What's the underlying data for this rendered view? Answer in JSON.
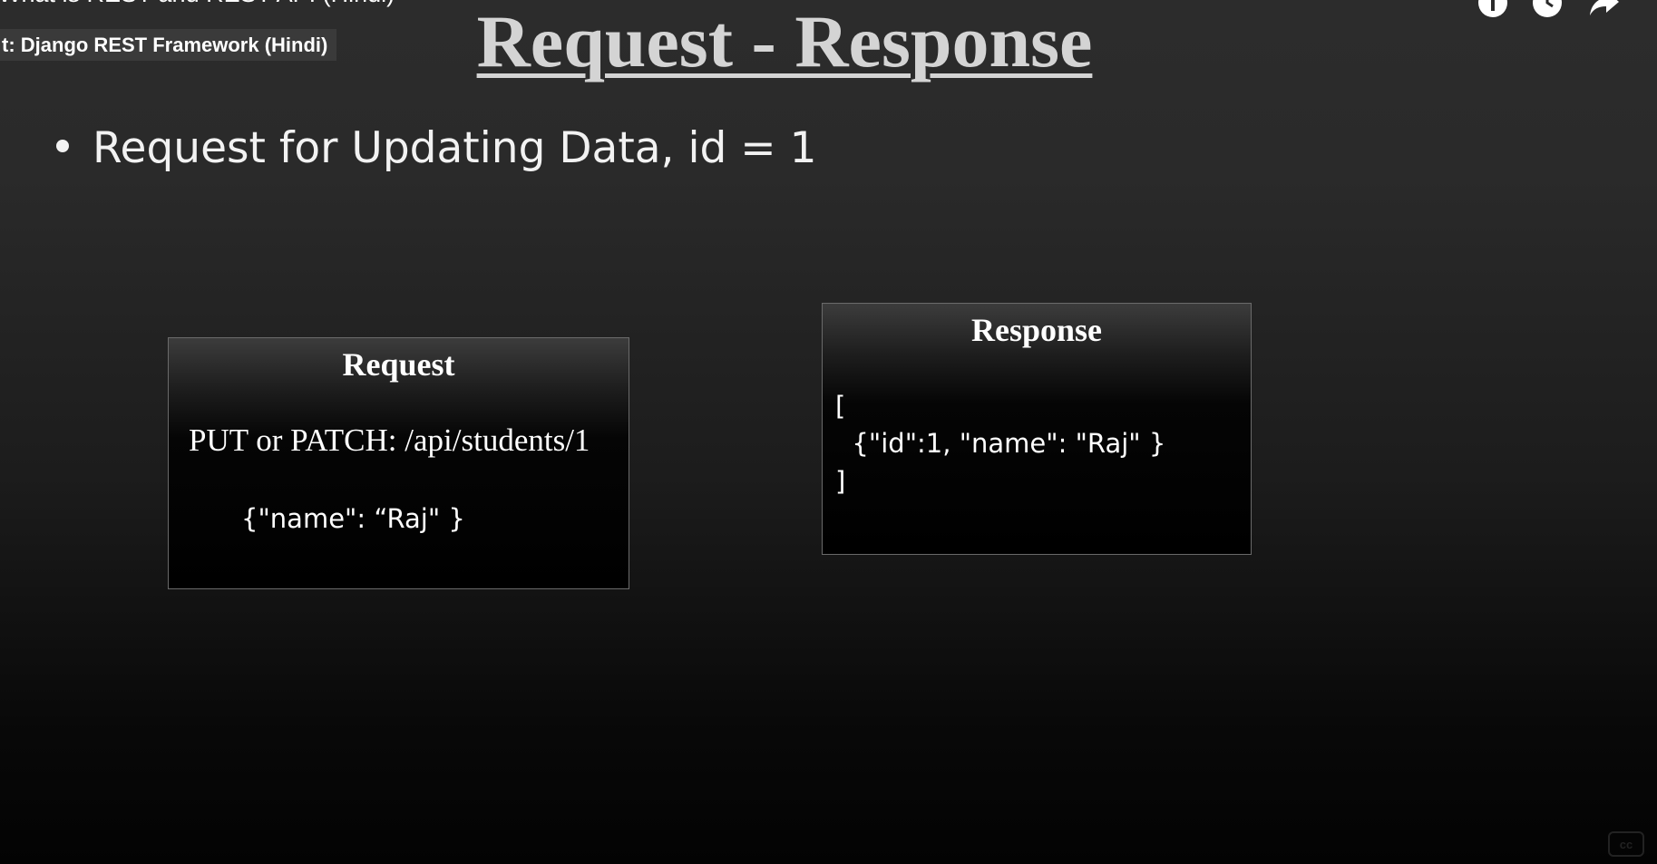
{
  "video": {
    "title": "What is REST and REST API (Hindi)",
    "playlist": "t: Django REST Framework (Hindi)"
  },
  "slide": {
    "title": "Request - Response",
    "bullet": "Request for Updating Data, id = 1",
    "request_box": {
      "heading": "Request",
      "method_line": "PUT or PATCH: /api/students/1",
      "body_line": "{\"name\": “Raj\" }"
    },
    "response_box": {
      "heading": "Response",
      "open_bracket": "[",
      "body_line": "  {\"id\":1, \"name\": \"Raj\" }",
      "close_bracket": "]"
    }
  },
  "icons": [
    "info-icon",
    "clock-icon",
    "share-icon",
    "cc-icon"
  ],
  "colors": {
    "title": "#d4d4d4",
    "text": "#ffffff",
    "background_top": "#2c2c2c",
    "background_bottom": "#030303"
  }
}
